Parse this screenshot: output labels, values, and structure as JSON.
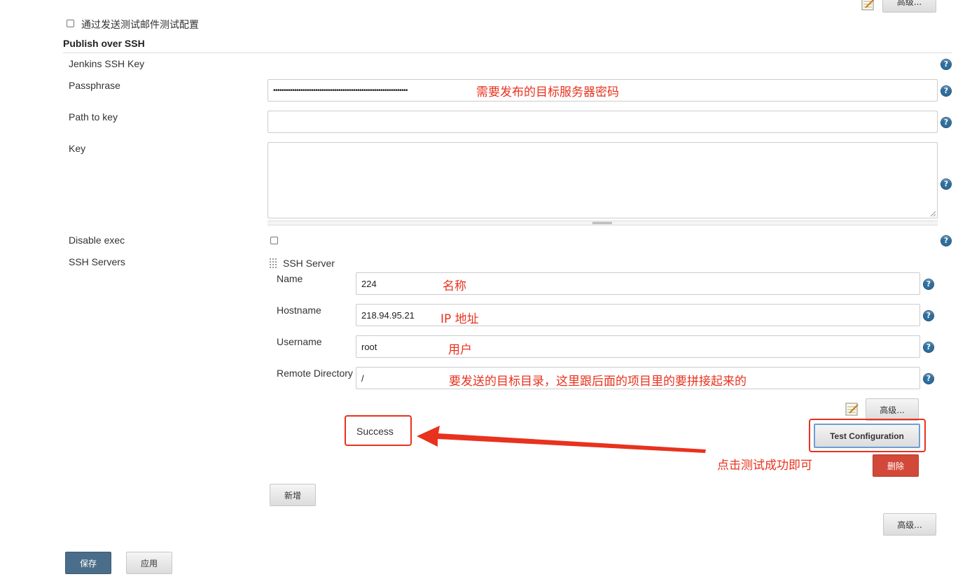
{
  "top": {
    "advanced_label": "高级...",
    "email_test_label": "通过发送测试邮件测试配置"
  },
  "section": {
    "title": "Publish over SSH"
  },
  "fields": {
    "jenkins_ssh_key_label": "Jenkins SSH Key",
    "passphrase_label": "Passphrase",
    "passphrase_value": "••••••••••••••••••••••••••••••••••••••••••••••••••••••••••••••••",
    "path_to_key_label": "Path to key",
    "path_to_key_value": "",
    "key_label": "Key",
    "key_value": "",
    "disable_exec_label": "Disable exec",
    "ssh_servers_label": "SSH Servers"
  },
  "ssh_server": {
    "header": "SSH Server",
    "name_label": "Name",
    "name_value": "224",
    "hostname_label": "Hostname",
    "hostname_value": "218.94.95.21",
    "username_label": "Username",
    "username_value": "root",
    "remote_dir_label": "Remote Directory",
    "remote_dir_value": "/",
    "advanced_label": "高级...",
    "test_config_label": "Test Configuration",
    "delete_label": "删除",
    "success_text": "Success"
  },
  "add_label": "新增",
  "bottom_advanced_label": "高级...",
  "save_label": "保存",
  "apply_label": "应用",
  "annotations": {
    "passphrase": "需要发布的目标服务器密码",
    "name": "名称",
    "hostname": "IP 地址",
    "username": "用户",
    "remote_dir": "要发送的目标目录，这里跟后面的项目里的要拼接起来的",
    "test": "点击测试成功即可"
  },
  "colors": {
    "annotation": "#e8321e",
    "save_button": "#4a6e8a",
    "delete_button": "#d24939",
    "help_icon": "#2f6f9f"
  }
}
